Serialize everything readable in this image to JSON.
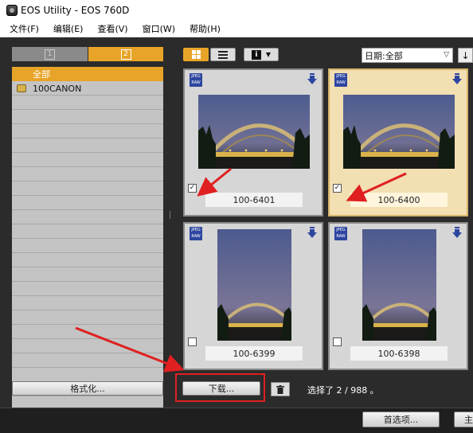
{
  "window": {
    "title": "EOS Utility -   EOS 760D"
  },
  "menu": [
    {
      "label": "文件(F)"
    },
    {
      "label": "编辑(E)"
    },
    {
      "label": "查看(V)"
    },
    {
      "label": "窗口(W)"
    },
    {
      "label": "帮助(H)"
    }
  ],
  "left": {
    "tabs": [
      {
        "label": "1"
      },
      {
        "label": "2"
      }
    ],
    "tree": {
      "all_label": "全部",
      "folder_label": "100CANON"
    },
    "format_button": "格式化..."
  },
  "toolbar": {
    "sort_value": "日期:全部",
    "sort_dir_icon": "↓",
    "info_icon": "i"
  },
  "grid": {
    "badge_text_top": "JPEG",
    "badge_text_bottom": "RAW",
    "items": [
      {
        "name": "100-6401",
        "checked": true,
        "selected": false,
        "orientation": "landscape"
      },
      {
        "name": "100-6400",
        "checked": true,
        "selected": true,
        "orientation": "landscape"
      },
      {
        "name": "100-6399",
        "checked": false,
        "selected": false,
        "orientation": "portrait"
      },
      {
        "name": "100-6398",
        "checked": false,
        "selected": false,
        "orientation": "portrait"
      }
    ]
  },
  "bottom": {
    "download_button": "下载...",
    "status": "选择了 2 / 988 。",
    "prefs_button": "首选项...",
    "main_button": "主"
  },
  "colors": {
    "accent": "#e8a428",
    "annotation": "#e02020"
  }
}
